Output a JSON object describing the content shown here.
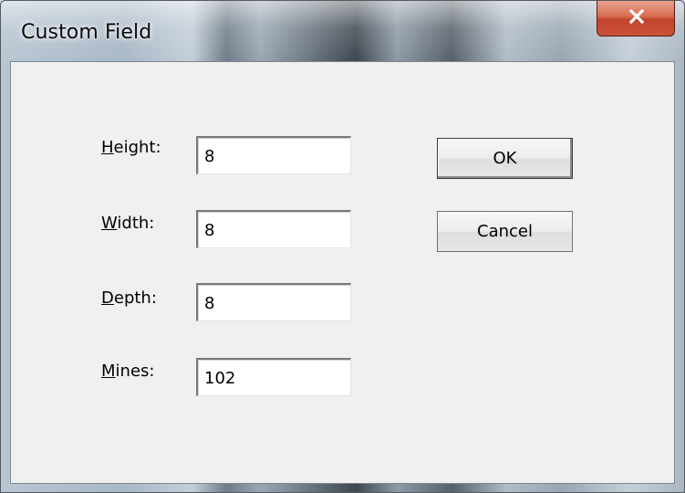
{
  "window": {
    "title": "Custom Field"
  },
  "form": {
    "fields": [
      {
        "label_accel": "H",
        "label_rest": "eight:",
        "value": "8"
      },
      {
        "label_accel": "W",
        "label_rest": "idth:",
        "value": "8"
      },
      {
        "label_accel": "D",
        "label_rest": "epth:",
        "value": "8"
      },
      {
        "label_accel": "M",
        "label_rest": "ines:",
        "value": "102"
      }
    ]
  },
  "buttons": {
    "ok_label": "OK",
    "cancel_label": "Cancel"
  },
  "icons": {
    "close": "close-icon"
  }
}
